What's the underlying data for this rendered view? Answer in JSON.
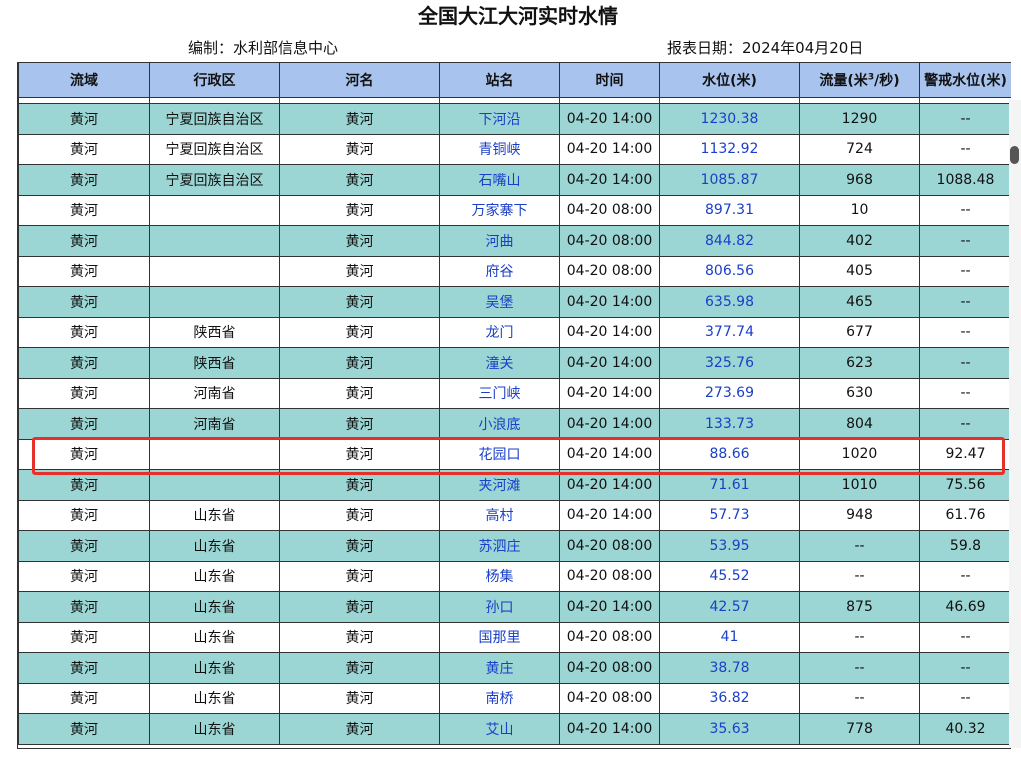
{
  "title": "全国大江大河实时水情",
  "editor": "编制：水利部信息中心",
  "report_date": "报表日期：2024年04月20日",
  "columns": {
    "basin": "流域",
    "region": "行政区",
    "river": "河名",
    "station": "站名",
    "time": "时间",
    "level": "水位(米)",
    "flow_prefix": "流量(米",
    "flow_sup": "3",
    "flow_suffix": "/秒)",
    "warning": "警戒水位(米)"
  },
  "rows": [
    {
      "basin": "黄河",
      "region": "宁夏回族自治区",
      "river": "黄河",
      "station": "下河沿",
      "time": "04-20 14:00",
      "level": "1230.38",
      "flow": "1290",
      "warning": "--"
    },
    {
      "basin": "黄河",
      "region": "宁夏回族自治区",
      "river": "黄河",
      "station": "青铜峡",
      "time": "04-20 14:00",
      "level": "1132.92",
      "flow": "724",
      "warning": "--"
    },
    {
      "basin": "黄河",
      "region": "宁夏回族自治区",
      "river": "黄河",
      "station": "石嘴山",
      "time": "04-20 14:00",
      "level": "1085.87",
      "flow": "968",
      "warning": "1088.48"
    },
    {
      "basin": "黄河",
      "region": "",
      "river": "黄河",
      "station": "万家寨下",
      "time": "04-20 08:00",
      "level": "897.31",
      "flow": "10",
      "warning": "--"
    },
    {
      "basin": "黄河",
      "region": "",
      "river": "黄河",
      "station": "河曲",
      "time": "04-20 08:00",
      "level": "844.82",
      "flow": "402",
      "warning": "--"
    },
    {
      "basin": "黄河",
      "region": "",
      "river": "黄河",
      "station": "府谷",
      "time": "04-20 08:00",
      "level": "806.56",
      "flow": "405",
      "warning": "--"
    },
    {
      "basin": "黄河",
      "region": "",
      "river": "黄河",
      "station": "吴堡",
      "time": "04-20 14:00",
      "level": "635.98",
      "flow": "465",
      "warning": "--"
    },
    {
      "basin": "黄河",
      "region": "陕西省",
      "river": "黄河",
      "station": "龙门",
      "time": "04-20 14:00",
      "level": "377.74",
      "flow": "677",
      "warning": "--"
    },
    {
      "basin": "黄河",
      "region": "陕西省",
      "river": "黄河",
      "station": "潼关",
      "time": "04-20 14:00",
      "level": "325.76",
      "flow": "623",
      "warning": "--"
    },
    {
      "basin": "黄河",
      "region": "河南省",
      "river": "黄河",
      "station": "三门峡",
      "time": "04-20 14:00",
      "level": "273.69",
      "flow": "630",
      "warning": "--"
    },
    {
      "basin": "黄河",
      "region": "河南省",
      "river": "黄河",
      "station": "小浪底",
      "time": "04-20 14:00",
      "level": "133.73",
      "flow": "804",
      "warning": "--"
    },
    {
      "basin": "黄河",
      "region": "",
      "river": "黄河",
      "station": "花园口",
      "time": "04-20 14:00",
      "level": "88.66",
      "flow": "1020",
      "warning": "92.47"
    },
    {
      "basin": "黄河",
      "region": "",
      "river": "黄河",
      "station": "夹河滩",
      "time": "04-20 14:00",
      "level": "71.61",
      "flow": "1010",
      "warning": "75.56"
    },
    {
      "basin": "黄河",
      "region": "山东省",
      "river": "黄河",
      "station": "高村",
      "time": "04-20 14:00",
      "level": "57.73",
      "flow": "948",
      "warning": "61.76"
    },
    {
      "basin": "黄河",
      "region": "山东省",
      "river": "黄河",
      "station": "苏泗庄",
      "time": "04-20 08:00",
      "level": "53.95",
      "flow": "--",
      "warning": "59.8"
    },
    {
      "basin": "黄河",
      "region": "山东省",
      "river": "黄河",
      "station": "杨集",
      "time": "04-20 08:00",
      "level": "45.52",
      "flow": "--",
      "warning": "--"
    },
    {
      "basin": "黄河",
      "region": "山东省",
      "river": "黄河",
      "station": "孙口",
      "time": "04-20 14:00",
      "level": "42.57",
      "flow": "875",
      "warning": "46.69"
    },
    {
      "basin": "黄河",
      "region": "山东省",
      "river": "黄河",
      "station": "国那里",
      "time": "04-20 08:00",
      "level": "41",
      "flow": "--",
      "warning": "--"
    },
    {
      "basin": "黄河",
      "region": "山东省",
      "river": "黄河",
      "station": "黄庄",
      "time": "04-20 08:00",
      "level": "38.78",
      "flow": "--",
      "warning": "--"
    },
    {
      "basin": "黄河",
      "region": "山东省",
      "river": "黄河",
      "station": "南桥",
      "time": "04-20 08:00",
      "level": "36.82",
      "flow": "--",
      "warning": "--"
    },
    {
      "basin": "黄河",
      "region": "山东省",
      "river": "黄河",
      "station": "艾山",
      "time": "04-20 14:00",
      "level": "35.63",
      "flow": "778",
      "warning": "40.32"
    }
  ],
  "colors": {
    "header_bg": "#a8c4ee",
    "alt_row_bg": "#9bd6d4",
    "link": "#1a3fc8",
    "highlight": "#e8302a"
  }
}
